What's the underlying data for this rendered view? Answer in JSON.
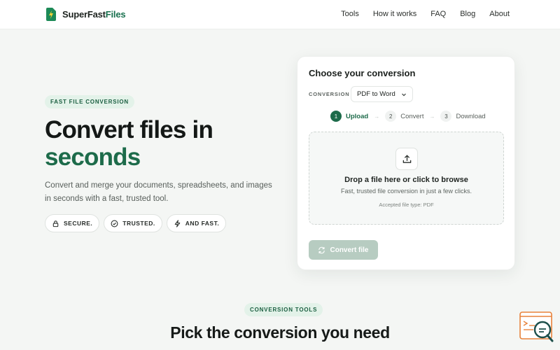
{
  "nav": {
    "brand_main": "SuperFast",
    "brand_accent": "Files",
    "links": [
      "Tools",
      "How it works",
      "FAQ",
      "Blog",
      "About"
    ]
  },
  "hero": {
    "pill": "FAST FILE CONVERSION",
    "title_line1": "Convert files in",
    "title_line2": "seconds",
    "subtitle": "Convert and merge your documents, spreadsheets, and images in seconds with a fast, trusted tool.",
    "badges": [
      {
        "label": "SECURE.",
        "icon": "lock-icon"
      },
      {
        "label": "TRUSTED.",
        "icon": "check-circle-icon"
      },
      {
        "label": "AND FAST.",
        "icon": "bolt-icon"
      }
    ]
  },
  "card": {
    "title": "Choose your conversion",
    "conversion_label": "CONVERSION",
    "conversion_value": "PDF to Word",
    "steps": [
      {
        "num": "1",
        "label": "Upload",
        "active": true
      },
      {
        "num": "2",
        "label": "Convert",
        "active": false
      },
      {
        "num": "3",
        "label": "Download",
        "active": false
      }
    ],
    "drop_title": "Drop a file here or click to browse",
    "drop_sub": "Fast, trusted file conversion in just a few clicks.",
    "drop_types": "Accepted file type: PDF",
    "convert_button": "Convert file"
  },
  "tools": {
    "pill": "CONVERSION TOOLS",
    "title": "Pick the conversion you need"
  },
  "colors": {
    "accent": "#1d6b4a",
    "accent_light": "#e3f2e9",
    "disabled_button": "#b7ccc1",
    "widget_orange": "#e8823a"
  }
}
